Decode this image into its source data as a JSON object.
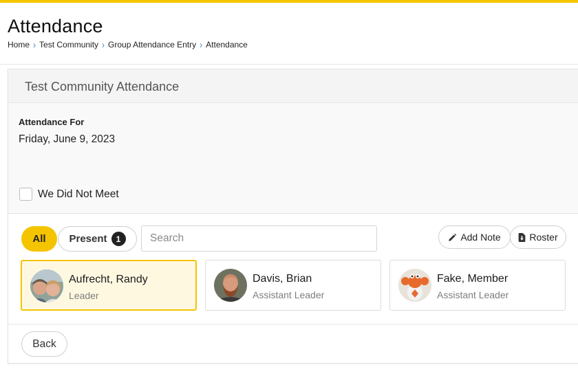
{
  "header": {
    "title": "Attendance",
    "breadcrumb": [
      "Home",
      "Test Community",
      "Group Attendance Entry",
      "Attendance"
    ]
  },
  "panel": {
    "title": "Test Community Attendance",
    "attendance_for_label": "Attendance For",
    "attendance_date": "Friday, June 9, 2023",
    "did_not_meet_label": "We Did Not Meet",
    "did_not_meet_checked": false
  },
  "filters": {
    "all_label": "All",
    "present_label": "Present",
    "present_count": "1",
    "search_placeholder": "Search",
    "add_note_label": "Add Note",
    "roster_label": "Roster"
  },
  "members": [
    {
      "name": "Aufrecht, Randy",
      "role": "Leader",
      "selected": true
    },
    {
      "name": "Davis, Brian",
      "role": "Assistant Leader",
      "selected": false
    },
    {
      "name": "Fake, Member",
      "role": "Assistant Leader",
      "selected": false
    }
  ],
  "footer": {
    "back_label": "Back"
  },
  "colors": {
    "accent": "#f5c400",
    "selected_bg": "#fff8e1",
    "link": "#4a86c5"
  }
}
